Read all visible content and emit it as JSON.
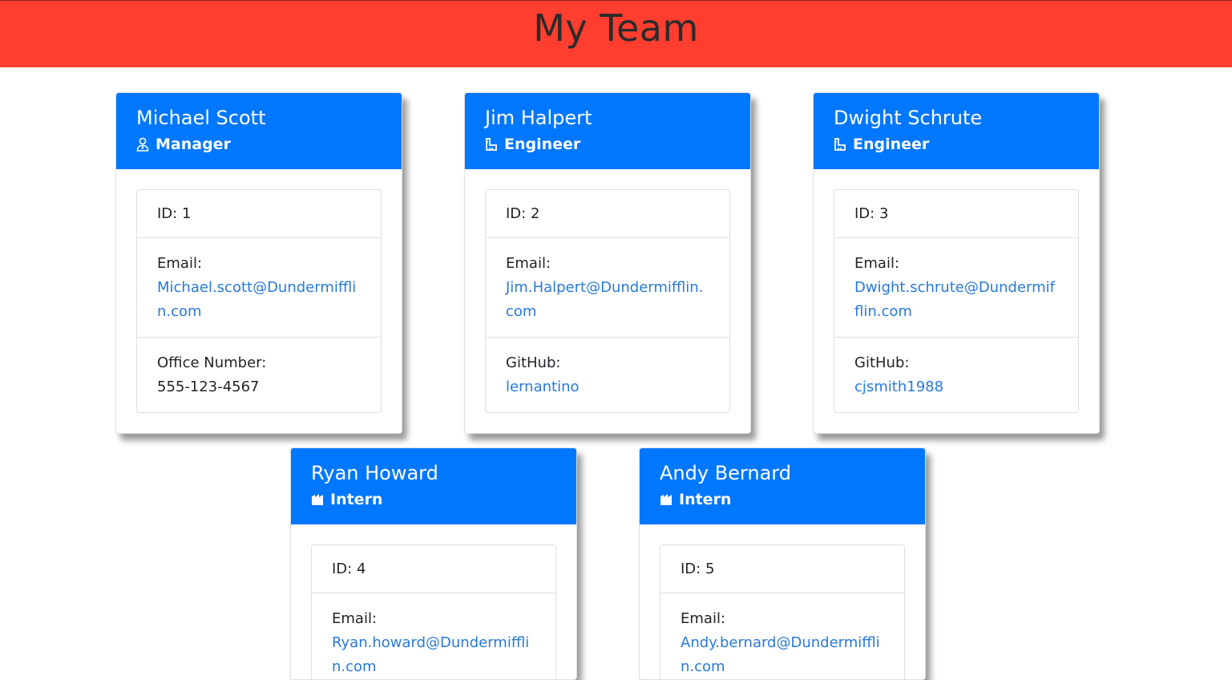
{
  "header": {
    "title": "My Team"
  },
  "colors": {
    "header_bg": "#ff3e2f",
    "card_header_bg": "#0077ff",
    "link": "#2979d9"
  },
  "employees": [
    {
      "name": "Michael Scott",
      "role": "Manager",
      "icon": "user-tie-icon",
      "id_text": "ID: 1",
      "email_label": "Email:",
      "email": "Michael.scott@Dundermifflin.com",
      "extra_label": "Office Number:",
      "extra_value": "555-123-4567"
    },
    {
      "name": "Jim Halpert",
      "role": "Engineer",
      "icon": "engineer-icon",
      "id_text": "ID: 2",
      "email_label": "Email:",
      "email": "Jim.Halpert@Dundermifflin.com",
      "extra_label": "GitHub:",
      "extra_value": "lernantino"
    },
    {
      "name": "Dwight Schrute",
      "role": "Engineer",
      "icon": "engineer-icon",
      "id_text": "ID: 3",
      "email_label": "Email:",
      "email": "Dwight.schrute@Dundermifflin.com",
      "extra_label": "GitHub:",
      "extra_value": "cjsmith1988"
    },
    {
      "name": "Ryan Howard",
      "role": "Intern",
      "icon": "intern-icon",
      "id_text": "ID: 4",
      "email_label": "Email:",
      "email": "Ryan.howard@Dundermifflin.com"
    },
    {
      "name": "Andy Bernard",
      "role": "Intern",
      "icon": "intern-icon",
      "id_text": "ID: 5",
      "email_label": "Email:",
      "email": "Andy.bernard@Dundermifflin.com"
    }
  ]
}
